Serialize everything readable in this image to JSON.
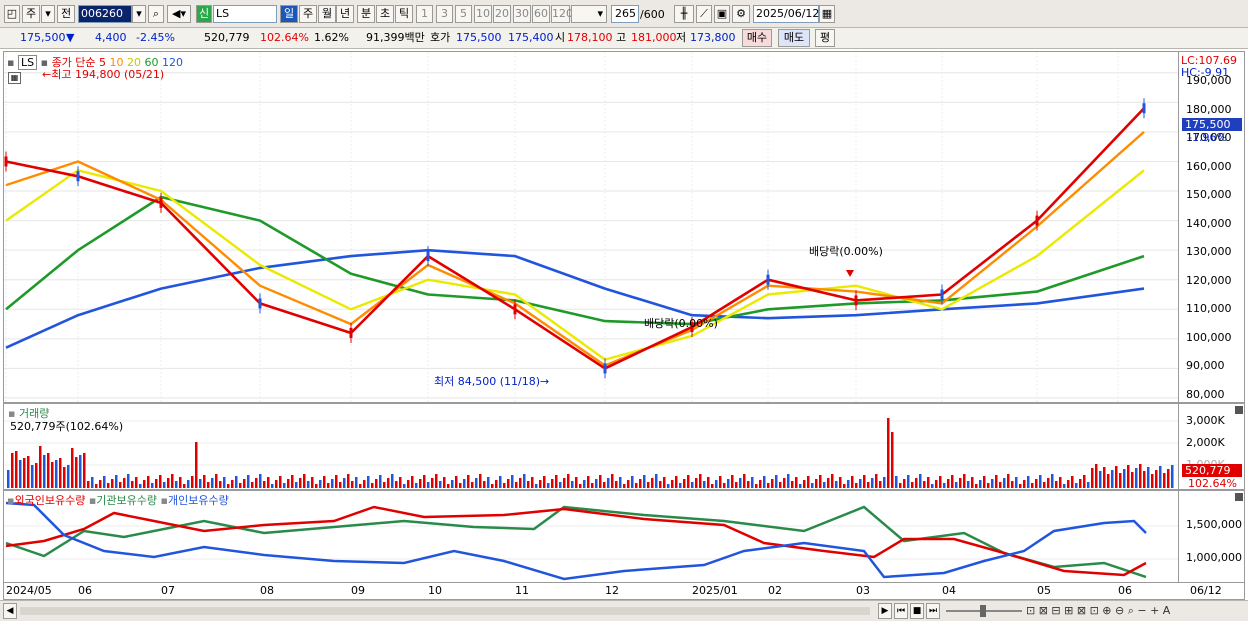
{
  "toolbar": {
    "ju": "주",
    "jeon": "전",
    "code": "006260",
    "sin": "신",
    "name": "LS",
    "periods": [
      "일",
      "주",
      "월",
      "년",
      "분",
      "초",
      "틱"
    ],
    "numbers": [
      "1",
      "3",
      "5",
      "10",
      "20",
      "30",
      "60",
      "120"
    ],
    "count": "265",
    "count_total": "/600",
    "date": "2025/06/12"
  },
  "quote": {
    "price": "175,500",
    "arrow": "▼",
    "change": "4,400",
    "change_pct": "-2.45%",
    "volume": "520,779",
    "volume_ratio": "102.64%",
    "turnover_pct": "1.62%",
    "amount": "91,399백만",
    "bid_label": "호가",
    "ask": "175,500",
    "bid": "175,400",
    "open_label": "시",
    "open": "178,100",
    "high_label": "고",
    "high": "181,000",
    "low_label": "저",
    "low": "173,800",
    "buy": "매수",
    "sell": "매도",
    "avg": "평"
  },
  "price_panel": {
    "name_tag": "LS",
    "legend_prefix": "종가 단순",
    "ma": [
      {
        "label": "5",
        "color": "#e00000"
      },
      {
        "label": "10",
        "color": "#ff8c00"
      },
      {
        "label": "20",
        "color": "#e8e800"
      },
      {
        "label": "60",
        "color": "#1f9a2a"
      },
      {
        "label": "120",
        "color": "#2255dd"
      }
    ],
    "max_label": "최고 194,800 (05/21)",
    "min_label": "최저 84,500 (11/18)",
    "div1": "배당락(0.00%)",
    "div2": "배당락(0.00%)",
    "lc": "LC:107.69",
    "hc": "HC:-9.91",
    "y_ticks": [
      "190,000",
      "180,000",
      "170,000",
      "160,000",
      "150,000",
      "140,000",
      "130,000",
      "120,000",
      "110,000",
      "100,000",
      "90,000",
      "80,000"
    ],
    "price_tag": "175,500",
    "pct_tag": "-1.96%"
  },
  "volume_panel": {
    "title": "거래량",
    "value": "520,779주(102.64%)",
    "y_ticks": [
      "3,000K",
      "2,000K",
      "1,000K"
    ],
    "tag": "520,779",
    "pct": "102.64%"
  },
  "holding_panel": {
    "legend": [
      {
        "label": "외국인보유수량",
        "color": "#e00000"
      },
      {
        "label": "기관보유수량",
        "color": "#2a8a4a"
      },
      {
        "label": "개인보유수량",
        "color": "#2255dd"
      }
    ],
    "y_ticks": [
      "1,500,000",
      "1,000,000"
    ]
  },
  "x_axis": [
    "2024/05",
    "06",
    "07",
    "08",
    "09",
    "10",
    "11",
    "12",
    "2025/01",
    "02",
    "03",
    "04",
    "05",
    "06",
    "06/12"
  ],
  "chart_data": {
    "type": "line",
    "title": "",
    "xlabel": "",
    "ylabel": "",
    "x": [
      "2024/05",
      "06",
      "07",
      "08",
      "09",
      "10",
      "11",
      "12",
      "2025/01",
      "02",
      "03",
      "04",
      "05",
      "06"
    ],
    "ylim": [
      80000,
      195000
    ],
    "series": [
      {
        "name": "5",
        "values": [
          160000,
          155000,
          146000,
          112000,
          102000,
          128000,
          110000,
          90000,
          104000,
          120000,
          113000,
          115000,
          140000,
          178000
        ]
      },
      {
        "name": "10",
        "values": [
          152000,
          160000,
          147000,
          118000,
          105000,
          125000,
          112000,
          91000,
          103000,
          118000,
          116000,
          112000,
          138000,
          170000
        ]
      },
      {
        "name": "20",
        "values": [
          140000,
          157000,
          150000,
          125000,
          110000,
          120000,
          115000,
          93000,
          101000,
          115000,
          118000,
          110000,
          128000,
          157000
        ]
      },
      {
        "name": "60",
        "values": [
          110000,
          130000,
          148000,
          140000,
          122000,
          115000,
          113000,
          106000,
          105000,
          110000,
          112000,
          113000,
          116000,
          128000
        ]
      },
      {
        "name": "120",
        "values": [
          97000,
          108000,
          117000,
          124000,
          128000,
          130000,
          128000,
          117000,
          108000,
          107000,
          108000,
          110000,
          112000,
          117000
        ]
      }
    ]
  }
}
